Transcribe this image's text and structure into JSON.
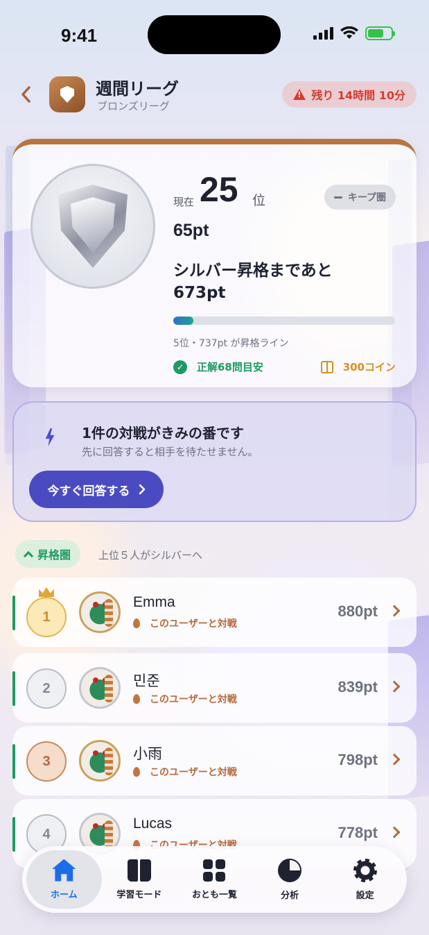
{
  "status_bar": {
    "time": "9:41"
  },
  "header": {
    "back_icon": "chevron-left-icon",
    "title": "週間リーグ",
    "subtitle": "ブロンズリーグ",
    "time_left": "残り 14時間 10分"
  },
  "rank_card": {
    "rank_prefix": "現在",
    "rank": "25",
    "rank_suffix": "位",
    "zone_label": "キープ圏",
    "points": "65pt",
    "promotion_text": "シルバー昇格まであと 673pt",
    "promotion_progress": 0.09,
    "promotion_line": "5位・737pt が昇格ライン",
    "correct_estimate": "正解68問目安",
    "reward": "300コイン"
  },
  "battle_card": {
    "title": "1件の対戦がきみの番です",
    "subtitle": "先に回答すると相手を待たせません。",
    "button_label": "今すぐ回答する"
  },
  "zone_section": {
    "badge": "昇格圏",
    "description": "上位５人がシルバーへ"
  },
  "ranking": [
    {
      "rank": "1",
      "name": "Emma",
      "challenge": "このユーザーと対戦",
      "points": "880pt",
      "medal": "gold"
    },
    {
      "rank": "2",
      "name": "민준",
      "challenge": "このユーザーと対戦",
      "points": "839pt",
      "medal": "silver"
    },
    {
      "rank": "3",
      "name": "小雨",
      "challenge": "このユーザーと対戦",
      "points": "798pt",
      "medal": "bronze"
    },
    {
      "rank": "4",
      "name": "Lucas",
      "challenge": "このユーザーと対戦",
      "points": "778pt",
      "medal": "plain"
    }
  ],
  "tab_bar": [
    {
      "label": "ホーム",
      "icon": "home-icon",
      "active": true
    },
    {
      "label": "学習モード",
      "icon": "book-icon",
      "active": false
    },
    {
      "label": "おとも一覧",
      "icon": "grid-icon",
      "active": false
    },
    {
      "label": "分析",
      "icon": "pie-chart-icon",
      "active": false
    },
    {
      "label": "設定",
      "icon": "gear-icon",
      "active": false
    }
  ],
  "colors": {
    "accent": "#4a4bc1",
    "bronze": "#b9743f",
    "success": "#1e9a63",
    "warning": "#d33b2e",
    "active_tab": "#1a6de8"
  }
}
